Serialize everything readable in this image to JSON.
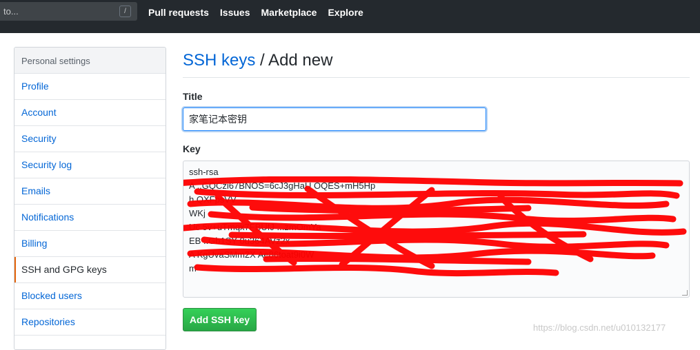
{
  "header": {
    "search_placeholder": "to...",
    "search_shortcut": "/",
    "nav": [
      "Pull requests",
      "Issues",
      "Marketplace",
      "Explore"
    ]
  },
  "sidebar": {
    "heading": "Personal settings",
    "items": [
      {
        "label": "Profile",
        "active": false
      },
      {
        "label": "Account",
        "active": false
      },
      {
        "label": "Security",
        "active": false
      },
      {
        "label": "Security log",
        "active": false
      },
      {
        "label": "Emails",
        "active": false
      },
      {
        "label": "Notifications",
        "active": false
      },
      {
        "label": "Billing",
        "active": false
      },
      {
        "label": "SSH and GPG keys",
        "active": true
      },
      {
        "label": "Blocked users",
        "active": false
      },
      {
        "label": "Repositories",
        "active": false
      }
    ]
  },
  "main": {
    "title_link": "SSH keys",
    "title_rest": " / Add new",
    "title_label": "Title",
    "title_value": "家笔记本密钥",
    "key_label": "Key",
    "key_lines": [
      "ssh-rsa",
      "A                                  ..GQCzi67BNOS=6cJ3gHaU                   OQES+mH5Hp",
      "h                                                                                QXFpsVV",
      "                                                                                    WKj",
      "Uc    5v+uTmqx7FBUfJ                                                       ...zmOmYa",
      "EB                                                                  ..Gb1SY      0u364AVz2x",
      "A  KgUvaSMm2X   Ae86toat9i0W",
      "          m"
    ],
    "add_button": "Add SSH key"
  },
  "watermark": "https://blog.csdn.net/u010132177",
  "colors": {
    "header_bg": "#24292e",
    "link": "#0366d6",
    "active_accent": "#e36209",
    "button_green": "#28a745",
    "redaction_red": "#ff0000"
  }
}
